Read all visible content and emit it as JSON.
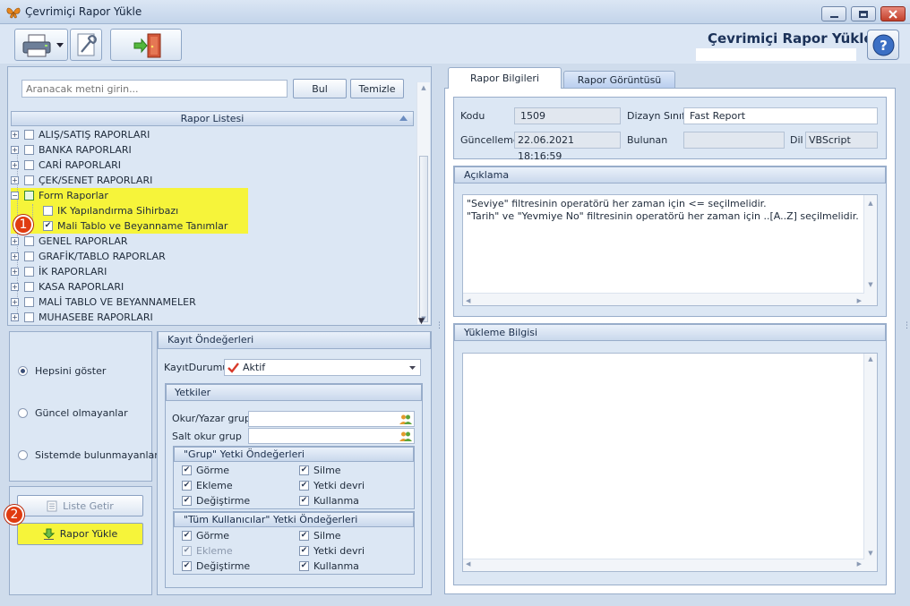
{
  "window": {
    "title": "Çevrimiçi Rapor Yükle"
  },
  "header": {
    "title": "Çevrimiçi Rapor Yükle"
  },
  "toolbar": {
    "print_icon": "printer-icon",
    "settings_icon": "settings-icon",
    "exit_icon": "exit-door-icon"
  },
  "search": {
    "placeholder": "Aranacak metni girin...",
    "find_label": "Bul",
    "clear_label": "Temizle"
  },
  "report_list": {
    "header": "Rapor Listesi",
    "items": [
      {
        "label": "ALIŞ/SATIŞ RAPORLARI",
        "expanded": false,
        "checked": false
      },
      {
        "label": "BANKA RAPORLARI",
        "expanded": false,
        "checked": false
      },
      {
        "label": "CARİ RAPORLARI",
        "expanded": false,
        "checked": false
      },
      {
        "label": "ÇEK/SENET RAPORLARI",
        "expanded": false,
        "checked": false
      },
      {
        "label": "Form Raporlar",
        "expanded": true,
        "checked": false,
        "children": [
          {
            "label": "IK Yapılandırma Sihirbazı",
            "checked": false
          },
          {
            "label": "Mali Tablo ve Beyanname Tanımlar",
            "checked": true
          }
        ]
      },
      {
        "label": "GENEL RAPORLAR",
        "expanded": false,
        "checked": false
      },
      {
        "label": "GRAFİK/TABLO RAPORLAR",
        "expanded": false,
        "checked": false
      },
      {
        "label": "İK RAPORLARI",
        "expanded": false,
        "checked": false
      },
      {
        "label": "KASA RAPORLARI",
        "expanded": false,
        "checked": false
      },
      {
        "label": "MALİ TABLO VE BEYANNAMELER",
        "expanded": false,
        "checked": false
      },
      {
        "label": "MUHASEBE RAPORLARI",
        "expanded": false,
        "checked": false
      }
    ]
  },
  "filter": {
    "options": [
      "Hepsini göster",
      "Güncel olmayanlar",
      "Sistemde bulunmayanlar"
    ],
    "selected": 0
  },
  "actions": {
    "list_label": "Liste Getir",
    "load_label": "Rapor Yükle"
  },
  "badges": {
    "one": "1",
    "two": "2"
  },
  "defaults": {
    "header": "Kayıt Öndeğerleri",
    "status_label": "KayıtDurumu",
    "status_value": "Aktif",
    "permissions_header": "Yetkiler",
    "rw_group_label": "Okur/Yazar grup",
    "ro_group_label": "Salt okur grup",
    "group_defaults": {
      "header": "\"Grup\" Yetki Öndeğerleri",
      "items": [
        {
          "label": "Görme",
          "checked": true,
          "enabled": true
        },
        {
          "label": "Silme",
          "checked": true,
          "enabled": true
        },
        {
          "label": "Ekleme",
          "checked": true,
          "enabled": true
        },
        {
          "label": "Yetki devri",
          "checked": true,
          "enabled": true
        },
        {
          "label": "Değiştirme",
          "checked": true,
          "enabled": true
        },
        {
          "label": "Kullanma",
          "checked": true,
          "enabled": true
        }
      ]
    },
    "all_users_defaults": {
      "header": "\"Tüm Kullanıcılar\" Yetki Öndeğerleri",
      "items": [
        {
          "label": "Görme",
          "checked": true,
          "enabled": true
        },
        {
          "label": "Silme",
          "checked": true,
          "enabled": true
        },
        {
          "label": "Ekleme",
          "checked": true,
          "enabled": false
        },
        {
          "label": "Yetki devri",
          "checked": true,
          "enabled": true
        },
        {
          "label": "Değiştirme",
          "checked": true,
          "enabled": true
        },
        {
          "label": "Kullanma",
          "checked": true,
          "enabled": true
        }
      ]
    }
  },
  "tabs": [
    {
      "label": "Rapor Bilgileri",
      "active": true
    },
    {
      "label": "Rapor Görüntüsü",
      "active": false
    }
  ],
  "info": {
    "code_label": "Kodu",
    "code_value": "1509",
    "designer_label": "Dizayn Sınıfı",
    "designer_value": "Fast Report",
    "updated_label": "Güncelleme",
    "updated_value": "22.06.2021 18:16:59",
    "found_label": "Bulunan",
    "found_value": "",
    "lang_label": "Dil",
    "lang_value": "VBScript"
  },
  "description": {
    "header": "Açıklama",
    "lines": [
      "\"Seviye\" filtresinin operatörü her zaman için <= seçilmelidir.",
      "\"Tarih\" ve \"Yevmiye No\" filtresinin operatörü her zaman için ..[A..Z] seçilmelidir."
    ]
  },
  "upload": {
    "header": "Yükleme Bilgisi"
  },
  "colors": {
    "highlight": "#f6f43a",
    "badge": "#e03b10",
    "accent": "#1b3158"
  }
}
